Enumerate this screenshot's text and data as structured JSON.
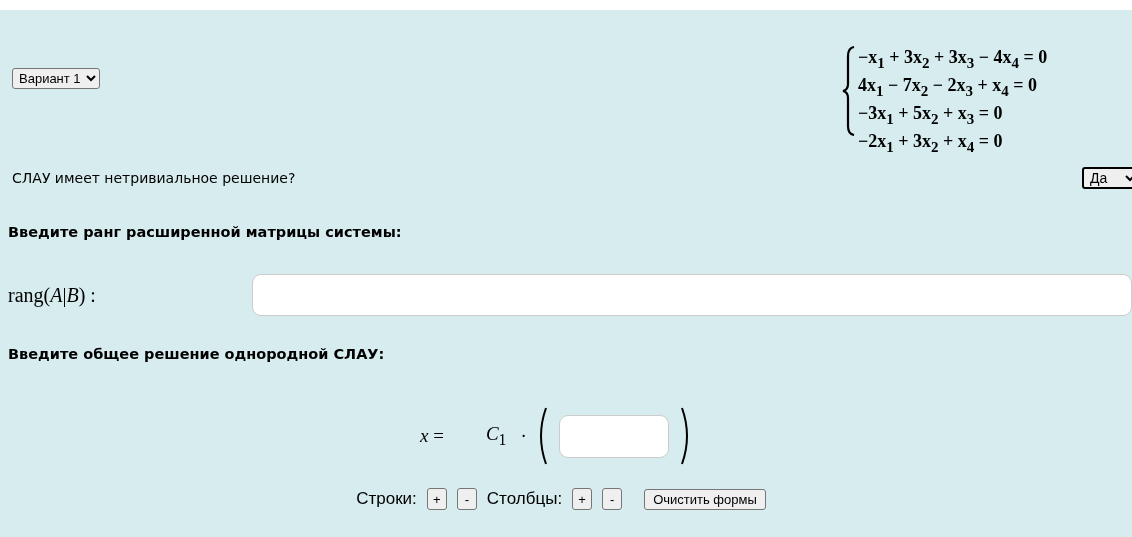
{
  "variant_select": {
    "value": "Вариант 1"
  },
  "system": {
    "equations": [
      "−x$_{1}$ + 3x$_{2}$ + 3x$_{3}$ − 4x$_{4}$ = 0",
      "4x$_{1}$ − 7x$_{2}$ − 2x$_{3}$ + x$_{4}$ = 0",
      "−3x$_{1}$ + 5x$_{2}$ + x$_{3}$ = 0",
      "−2x$_{1}$ + 3x$_{2}$ + x$_{4}$ = 0"
    ]
  },
  "question": {
    "label": "СЛАУ имеет нетривиальное решение?",
    "answer": "Да"
  },
  "rank_heading": "Введите ранг расширенной матрицы системы:",
  "rank_label": "rang(*A*|*B*) :",
  "solution_heading": "Введите общее решение однородной СЛАУ:",
  "solution": {
    "lhs": "*x* =",
    "constant": "*C*$_{1}$",
    "dot": "·"
  },
  "controls": {
    "rows_label": "Строки:",
    "rows_buttons": [
      "+",
      "-"
    ],
    "columns_label": "Столбцы:",
    "columns_buttons": [
      "+",
      "-"
    ],
    "clear_button": "Очистить формы"
  }
}
